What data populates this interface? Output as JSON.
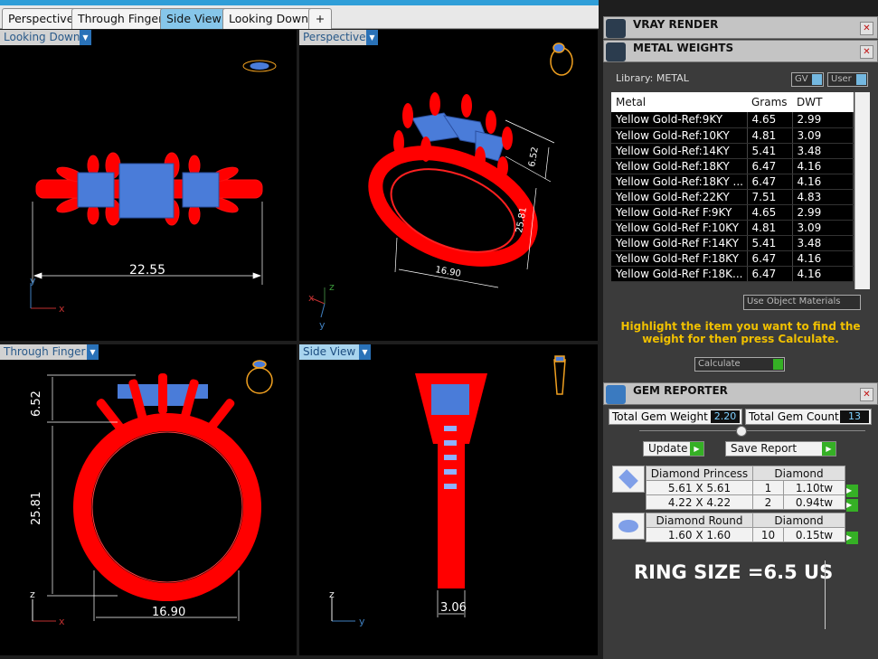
{
  "tabs": [
    "Perspective",
    "Through Finger",
    "Side View",
    "Looking Down"
  ],
  "tab_add": "+",
  "viewports": {
    "tl": {
      "label": "Looking Down",
      "dim": "22.55",
      "ax1": "x",
      "ax2": "y"
    },
    "tr": {
      "label": "Perspective",
      "dim1": "6.52",
      "dim2": "25.81",
      "dim3": "16.90",
      "ax1": "x",
      "ax2": "z",
      "ax3": "y"
    },
    "bl": {
      "label": "Through Finger",
      "dim1": "6.52",
      "dim2": "25.81",
      "dim3": "16.90",
      "ax1": "z",
      "ax2": "x"
    },
    "br": {
      "label": "Side View",
      "dim": "3.06",
      "ax1": "z",
      "ax2": "y"
    }
  },
  "colors": {
    "metal": "#ff0000",
    "gem": "#4a7cd9",
    "tab_active": "#86c6ea",
    "panel": "#3b3b3b",
    "highlight": "#f0c000"
  },
  "panel": {
    "vray_title": "VRAY RENDER",
    "metal_title": "METAL WEIGHTS",
    "library_label": "Library: METAL",
    "gv_label": "GV",
    "user_label": "User",
    "metal_table": {
      "headers": [
        "Metal",
        "Grams",
        "DWT"
      ],
      "rows": [
        [
          "Yellow Gold-Ref:9KY",
          "4.65",
          "2.99"
        ],
        [
          "Yellow Gold-Ref:10KY",
          "4.81",
          "3.09"
        ],
        [
          "Yellow Gold-Ref:14KY",
          "5.41",
          "3.48"
        ],
        [
          "Yellow Gold-Ref:18KY",
          "6.47",
          "4.16"
        ],
        [
          "Yellow Gold-Ref:18KY ...",
          "6.47",
          "4.16"
        ],
        [
          "Yellow Gold-Ref:22KY",
          "7.51",
          "4.83"
        ],
        [
          "Yellow Gold-Ref F:9KY",
          "4.65",
          "2.99"
        ],
        [
          "Yellow Gold-Ref F:10KY",
          "4.81",
          "3.09"
        ],
        [
          "Yellow Gold-Ref F:14KY",
          "5.41",
          "3.48"
        ],
        [
          "Yellow Gold-Ref F:18KY",
          "6.47",
          "4.16"
        ],
        [
          "Yellow Gold-Ref F:18K...",
          "6.47",
          "4.16"
        ]
      ]
    },
    "use_object_materials": "Use Object Materials",
    "highlight_text": "Highlight the item you want to find the weight for then press Calculate.",
    "calculate": "Calculate",
    "gem_title": "GEM REPORTER",
    "total_gem_weight_label": "Total Gem Weight",
    "total_gem_weight": "2.20",
    "total_gem_count_label": "Total Gem Count",
    "total_gem_count": "13",
    "update": "Update",
    "save_report": "Save Report",
    "gems": [
      {
        "shape": "Diamond Princess",
        "type": "Diamond",
        "rows": [
          [
            "5.61 X 5.61",
            "1",
            "1.10tw"
          ],
          [
            "4.22 X 4.22",
            "2",
            "0.94tw"
          ]
        ]
      },
      {
        "shape": "Diamond Round",
        "type": "Diamond",
        "rows": [
          [
            "1.60 X 1.60",
            "10",
            "0.15tw"
          ]
        ]
      }
    ],
    "ring_size": "RING SIZE =6.5 US"
  }
}
